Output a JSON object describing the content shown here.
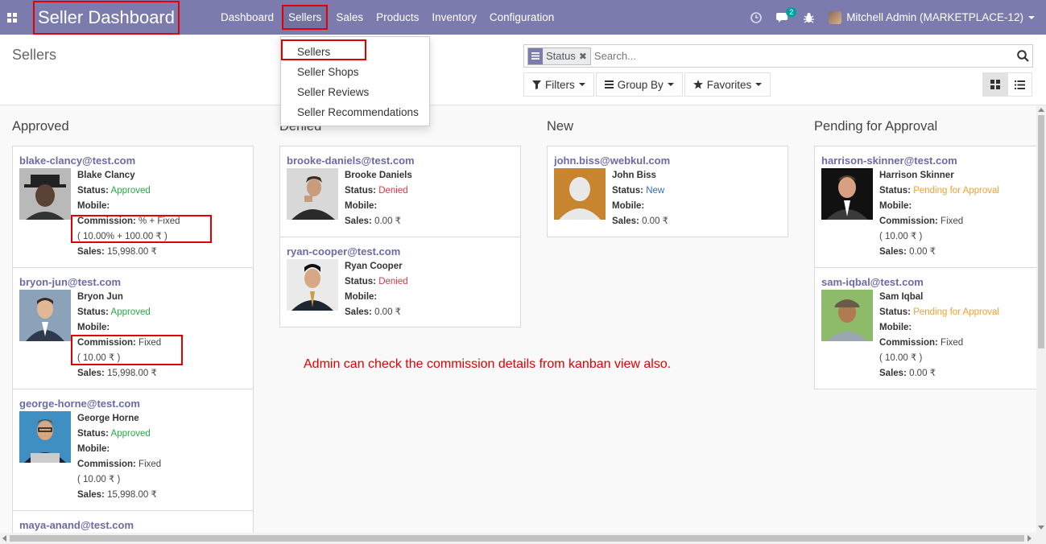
{
  "navbar": {
    "brand": "Seller Dashboard",
    "menu": [
      "Dashboard",
      "Sellers",
      "Sales",
      "Products",
      "Inventory",
      "Configuration"
    ],
    "chat_badge": "2",
    "user": "Mitchell Admin (MARKETPLACE-12)"
  },
  "sellers_menu": [
    "Sellers",
    "Seller Shops",
    "Seller Reviews",
    "Seller Recommendations"
  ],
  "control": {
    "breadcrumb": "Sellers",
    "facet": "Status",
    "search_placeholder": "Search...",
    "filters": "Filters",
    "group_by": "Group By",
    "favorites": "Favorites"
  },
  "columns": [
    {
      "title": "Approved",
      "cards": [
        {
          "email": "blake-clancy@test.com",
          "name": "Blake Clancy",
          "status_label": "Status:",
          "status": "Approved",
          "mobile_label": "Mobile:",
          "commission_label": "Commission:",
          "commission": "% + Fixed",
          "commission_detail": "( 10.00% + 100.00 ₹ )",
          "sales_label": "Sales:",
          "sales": "15,998.00 ₹"
        },
        {
          "email": "bryon-jun@test.com",
          "name": "Bryon Jun",
          "status_label": "Status:",
          "status": "Approved",
          "mobile_label": "Mobile:",
          "commission_label": "Commission:",
          "commission": "Fixed",
          "commission_detail": "( 10.00 ₹ )",
          "sales_label": "Sales:",
          "sales": "15,998.00 ₹"
        },
        {
          "email": "george-horne@test.com",
          "name": "George Horne",
          "status_label": "Status:",
          "status": "Approved",
          "mobile_label": "Mobile:",
          "commission_label": "Commission:",
          "commission": "Fixed",
          "commission_detail": "( 10.00 ₹ )",
          "sales_label": "Sales:",
          "sales": "15,998.00 ₹"
        },
        {
          "email": "maya-anand@test.com"
        }
      ]
    },
    {
      "title": "Denied",
      "cards": [
        {
          "email": "brooke-daniels@test.com",
          "name": "Brooke Daniels",
          "status_label": "Status:",
          "status": "Denied",
          "mobile_label": "Mobile:",
          "sales_label": "Sales:",
          "sales": "0.00 ₹"
        },
        {
          "email": "ryan-cooper@test.com",
          "name": "Ryan Cooper",
          "status_label": "Status:",
          "status": "Denied",
          "mobile_label": "Mobile:",
          "sales_label": "Sales:",
          "sales": "0.00 ₹"
        }
      ]
    },
    {
      "title": "New",
      "cards": [
        {
          "email": "john.biss@webkul.com",
          "name": "John Biss",
          "status_label": "Status:",
          "status": "New",
          "mobile_label": "Mobile:",
          "sales_label": "Sales:",
          "sales": "0.00 ₹"
        }
      ]
    },
    {
      "title": "Pending for Approval",
      "cards": [
        {
          "email": "harrison-skinner@test.com",
          "name": "Harrison Skinner",
          "status_label": "Status:",
          "status": "Pending for Approval",
          "mobile_label": "Mobile:",
          "commission_label": "Commission:",
          "commission": "Fixed",
          "commission_detail": "( 10.00 ₹ )",
          "sales_label": "Sales:",
          "sales": "0.00 ₹"
        },
        {
          "email": "sam-iqbal@test.com",
          "name": "Sam Iqbal",
          "status_label": "Status:",
          "status": "Pending for Approval",
          "mobile_label": "Mobile:",
          "commission_label": "Commission:",
          "commission": "Fixed",
          "commission_detail": "( 10.00 ₹ )",
          "sales_label": "Sales:",
          "sales": "0.00 ₹"
        }
      ]
    }
  ],
  "annotation": "Admin can check the commission details from kanban view also.",
  "colors": {
    "navbar": "#7c7bad",
    "highlight": "#e00000",
    "approved": "#28a745",
    "denied": "#dc3545",
    "new": "#2f6eb5",
    "pending": "#f0a030"
  }
}
